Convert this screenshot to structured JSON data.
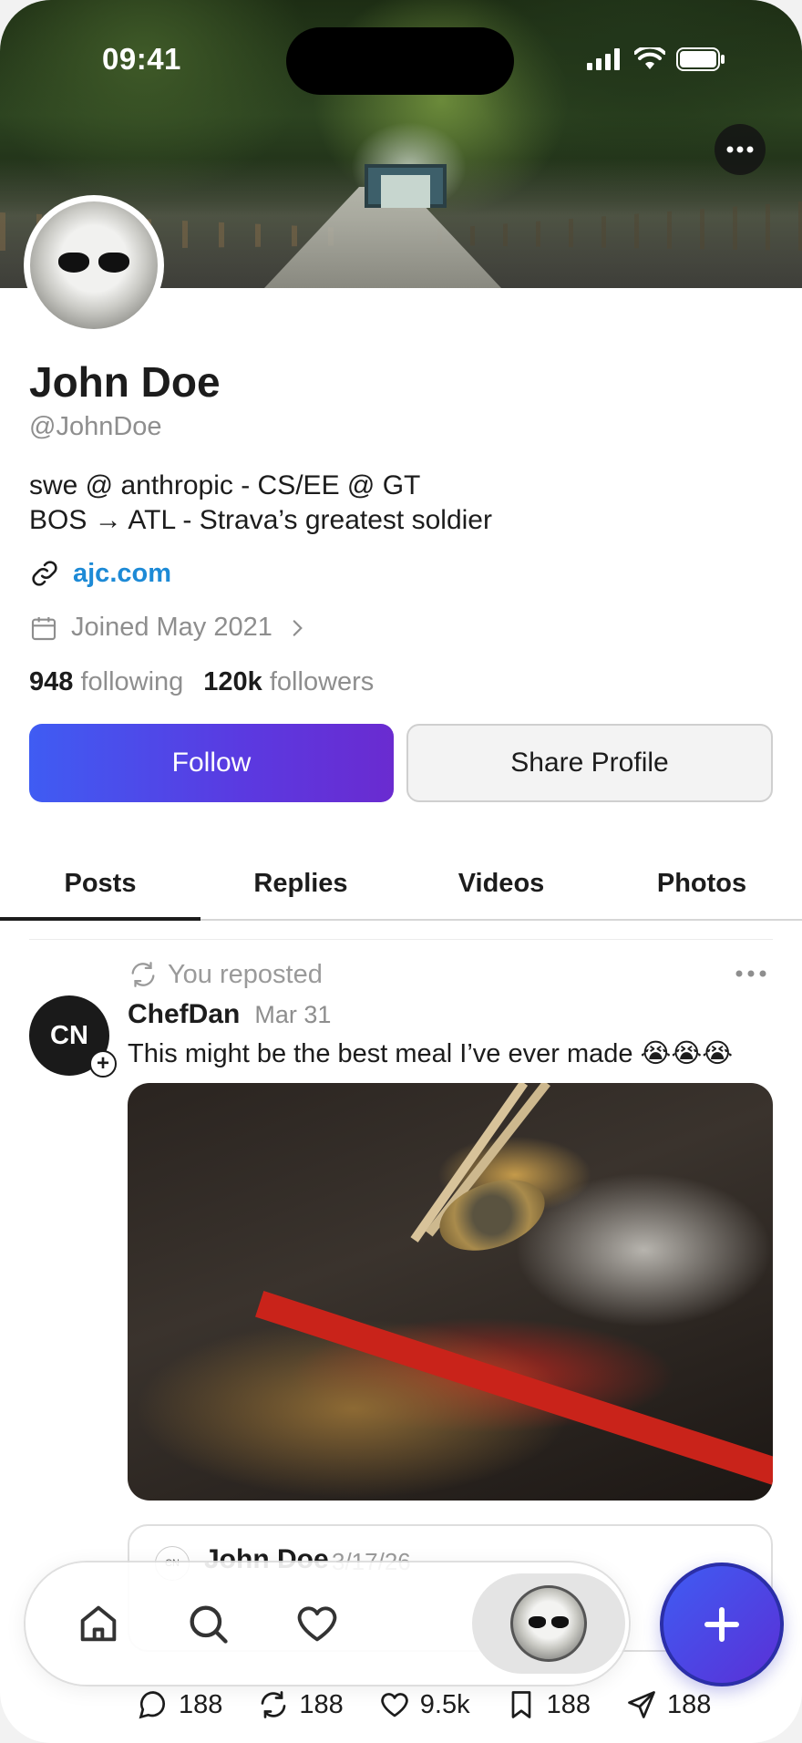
{
  "status_bar": {
    "time": "09:41"
  },
  "profile": {
    "name": "John Doe",
    "handle": "@JohnDoe",
    "bio_line1": "swe @ anthropic - CS/EE @ GT",
    "bio_line2": "BOS → ATL - Strava’s greatest soldier",
    "link": "ajc.com",
    "joined": "Joined May 2021",
    "following_count": "948",
    "following_label": "following",
    "followers_count": "120k",
    "followers_label": "followers"
  },
  "buttons": {
    "follow": "Follow",
    "share": "Share Profile"
  },
  "tabs": [
    {
      "label": "Posts",
      "active": true
    },
    {
      "label": "Replies",
      "active": false
    },
    {
      "label": "Videos",
      "active": false
    },
    {
      "label": "Photos",
      "active": false
    }
  ],
  "post": {
    "repost_label": "You reposted",
    "avatar_initials": "CN",
    "author": "ChefDan",
    "date": "Mar 31",
    "text": "This might be the best meal I’ve ever made 😭😭😭",
    "quote": {
      "avatar_initials": "CN",
      "author": "John Doe",
      "date": "3/17/26"
    },
    "actions": {
      "replies": "188",
      "reposts": "188",
      "likes": "9.5k",
      "bookmarks": "188",
      "shares": "188"
    }
  },
  "nav": {
    "items": [
      "home-icon",
      "search-icon",
      "heart-icon",
      "profile-avatar"
    ]
  },
  "colors": {
    "accent_start": "#3f5cf3",
    "accent_end": "#6a2bd0",
    "link": "#1d8ad6"
  }
}
